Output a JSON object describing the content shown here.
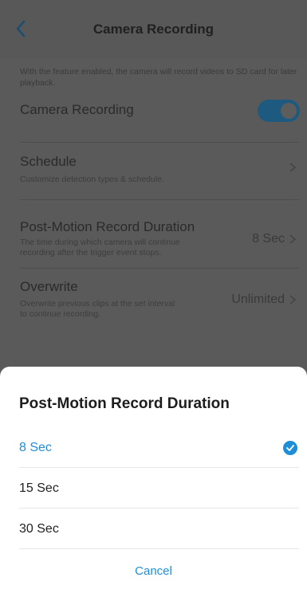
{
  "nav": {
    "title": "Camera Recording",
    "back_icon": "chevron-left-icon"
  },
  "intro": "With the feature enabled, the camera will record videos to SD card for later playback.",
  "recording": {
    "label": "Camera Recording",
    "enabled": true,
    "accent": "#1e5a80"
  },
  "schedule": {
    "title": "Schedule",
    "subtitle": "Customize detection types & schedule."
  },
  "post_motion": {
    "title": "Post-Motion Record Duration",
    "subtitle_1": "The time during which camera will continue",
    "subtitle_2": "recording after the trigger event stops.",
    "value": "8 Sec"
  },
  "overwrite": {
    "title": "Overwrite",
    "subtitle_1": "Overwrite previous clips at the set interval",
    "subtitle_2": "to continue recording.",
    "value": "Unlimited"
  },
  "sheet": {
    "title": "Post-Motion Record Duration",
    "options": [
      {
        "label": "8 Sec",
        "selected": true
      },
      {
        "label": "15 Sec",
        "selected": false
      },
      {
        "label": "30 Sec",
        "selected": false
      }
    ],
    "cancel_label": "Cancel",
    "accent": "#1f8ed8"
  }
}
